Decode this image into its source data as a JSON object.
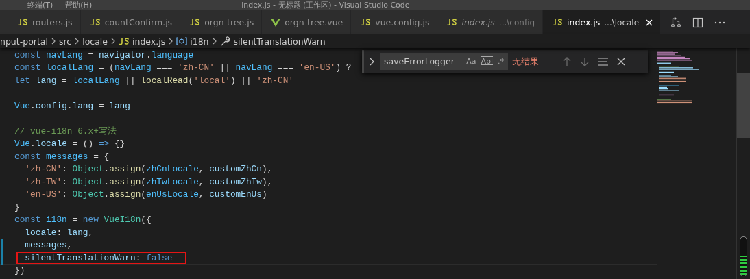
{
  "menu": [
    "终端(T)",
    "帮助(H)"
  ],
  "window": {
    "title": "index.js - 无标题 (工作区) - Visual Studio Code"
  },
  "tabs": [
    {
      "label": "routers.js",
      "kind": "js",
      "selected": false,
      "preview": false
    },
    {
      "label": "countConfirm.js",
      "kind": "js",
      "selected": false,
      "preview": false
    },
    {
      "label": "orgn-tree.js",
      "kind": "js",
      "selected": false,
      "preview": false
    },
    {
      "label": "orgn-tree.vue",
      "kind": "vue",
      "selected": false,
      "preview": false
    },
    {
      "label": "vue.config.js",
      "kind": "js",
      "selected": false,
      "preview": false
    },
    {
      "label": "index.js",
      "path": "...\\config",
      "kind": "js",
      "selected": false,
      "preview": true
    },
    {
      "label": "index.js",
      "path": "...\\locale",
      "kind": "js",
      "selected": true,
      "preview": false
    }
  ],
  "breadcrumb": [
    {
      "label": "nput-portal",
      "kind": "folder"
    },
    {
      "label": "src",
      "kind": "folder"
    },
    {
      "label": "locale",
      "kind": "folder"
    },
    {
      "label": "index.js",
      "kind": "js"
    },
    {
      "label": "i18n",
      "kind": "module"
    },
    {
      "label": "silentTranslationWarn",
      "kind": "property"
    }
  ],
  "find": {
    "value": "saveErrorLogger",
    "options": [
      "Aa",
      "Abl",
      ".*"
    ],
    "result": "无结果"
  },
  "code": [
    {
      "modified": false,
      "highlighted": false,
      "tokens": [
        {
          "kind": "keyword",
          "text": "const "
        },
        {
          "kind": "constant",
          "text": "navLang"
        },
        {
          "kind": "plain",
          "text": " = "
        },
        {
          "kind": "variable",
          "text": "navigator"
        },
        {
          "kind": "plain",
          "text": "."
        },
        {
          "kind": "constant",
          "text": "language"
        }
      ]
    },
    {
      "modified": false,
      "highlighted": false,
      "tokens": [
        {
          "kind": "keyword",
          "text": "const "
        },
        {
          "kind": "constant",
          "text": "localLang"
        },
        {
          "kind": "plain",
          "text": " = ("
        },
        {
          "kind": "constant",
          "text": "navLang"
        },
        {
          "kind": "plain",
          "text": " === "
        },
        {
          "kind": "string",
          "text": "'zh-CN'"
        },
        {
          "kind": "plain",
          "text": " || "
        },
        {
          "kind": "constant",
          "text": "navLang"
        },
        {
          "kind": "plain",
          "text": " === "
        },
        {
          "kind": "string",
          "text": "'en-US'"
        },
        {
          "kind": "plain",
          "text": ") ?"
        }
      ]
    },
    {
      "modified": false,
      "highlighted": false,
      "tokens": [
        {
          "kind": "keyword",
          "text": "let "
        },
        {
          "kind": "variable",
          "text": "lang"
        },
        {
          "kind": "plain",
          "text": " = "
        },
        {
          "kind": "constant",
          "text": "localLang"
        },
        {
          "kind": "plain",
          "text": " || "
        },
        {
          "kind": "function",
          "text": "localRead"
        },
        {
          "kind": "plain",
          "text": "("
        },
        {
          "kind": "string",
          "text": "'local'"
        },
        {
          "kind": "plain",
          "text": ") || "
        },
        {
          "kind": "string",
          "text": "'zh-CN'"
        }
      ]
    },
    {
      "modified": false,
      "highlighted": false
    },
    {
      "modified": false,
      "highlighted": false,
      "tokens": [
        {
          "kind": "constant",
          "text": "Vue"
        },
        {
          "kind": "plain",
          "text": "."
        },
        {
          "kind": "variable",
          "text": "config"
        },
        {
          "kind": "plain",
          "text": "."
        },
        {
          "kind": "variable",
          "text": "lang"
        },
        {
          "kind": "plain",
          "text": " = "
        },
        {
          "kind": "variable",
          "text": "lang"
        }
      ]
    },
    {
      "modified": false,
      "highlighted": false
    },
    {
      "modified": false,
      "highlighted": false,
      "tokens": [
        {
          "kind": "comment",
          "text": "// vue-i18n 6.x+写法"
        }
      ]
    },
    {
      "modified": false,
      "highlighted": false,
      "tokens": [
        {
          "kind": "constant",
          "text": "Vue"
        },
        {
          "kind": "plain",
          "text": "."
        },
        {
          "kind": "variable",
          "text": "locale"
        },
        {
          "kind": "plain",
          "text": " = () "
        },
        {
          "kind": "keyword",
          "text": "=>"
        },
        {
          "kind": "plain",
          "text": " {}"
        }
      ]
    },
    {
      "modified": false,
      "highlighted": false,
      "tokens": [
        {
          "kind": "keyword",
          "text": "const "
        },
        {
          "kind": "constant",
          "text": "messages"
        },
        {
          "kind": "plain",
          "text": " = {"
        }
      ]
    },
    {
      "modified": false,
      "highlighted": false,
      "tokens": [
        {
          "kind": "string",
          "text": "  'zh-CN'"
        },
        {
          "kind": "plain",
          "text": ": "
        },
        {
          "kind": "class",
          "text": "Object"
        },
        {
          "kind": "plain",
          "text": "."
        },
        {
          "kind": "function",
          "text": "assign"
        },
        {
          "kind": "plain",
          "text": "("
        },
        {
          "kind": "constant",
          "text": "zhCnLocale"
        },
        {
          "kind": "plain",
          "text": ", "
        },
        {
          "kind": "variable",
          "text": "customZhCn"
        },
        {
          "kind": "plain",
          "text": "),"
        }
      ]
    },
    {
      "modified": false,
      "highlighted": false,
      "tokens": [
        {
          "kind": "string",
          "text": "  'zh-TW'"
        },
        {
          "kind": "plain",
          "text": ": "
        },
        {
          "kind": "class",
          "text": "Object"
        },
        {
          "kind": "plain",
          "text": "."
        },
        {
          "kind": "function",
          "text": "assign"
        },
        {
          "kind": "plain",
          "text": "("
        },
        {
          "kind": "constant",
          "text": "zhTwLocale"
        },
        {
          "kind": "plain",
          "text": ", "
        },
        {
          "kind": "variable",
          "text": "customZhTw"
        },
        {
          "kind": "plain",
          "text": "),"
        }
      ]
    },
    {
      "modified": false,
      "highlighted": false,
      "tokens": [
        {
          "kind": "string",
          "text": "  'en-US'"
        },
        {
          "kind": "plain",
          "text": ": "
        },
        {
          "kind": "class",
          "text": "Object"
        },
        {
          "kind": "plain",
          "text": "."
        },
        {
          "kind": "function",
          "text": "assign"
        },
        {
          "kind": "plain",
          "text": "("
        },
        {
          "kind": "constant",
          "text": "enUsLocale"
        },
        {
          "kind": "plain",
          "text": ", "
        },
        {
          "kind": "variable",
          "text": "customEnUs"
        },
        {
          "kind": "plain",
          "text": ")"
        }
      ]
    },
    {
      "modified": false,
      "highlighted": false,
      "tokens": [
        {
          "kind": "plain",
          "text": "}"
        }
      ]
    },
    {
      "modified": false,
      "highlighted": false,
      "tokens": [
        {
          "kind": "keyword",
          "text": "const "
        },
        {
          "kind": "constant",
          "text": "i18n"
        },
        {
          "kind": "plain",
          "text": " = "
        },
        {
          "kind": "keyword",
          "text": "new "
        },
        {
          "kind": "class",
          "text": "VueI18n"
        },
        {
          "kind": "plain",
          "text": "({"
        }
      ]
    },
    {
      "modified": false,
      "highlighted": false,
      "tokens": [
        {
          "kind": "variable",
          "text": "  locale"
        },
        {
          "kind": "plain",
          "text": ": "
        },
        {
          "kind": "variable",
          "text": "lang"
        },
        {
          "kind": "plain",
          "text": ","
        }
      ]
    },
    {
      "modified": true,
      "highlighted": false,
      "tokens": [
        {
          "kind": "variable",
          "text": "  messages"
        },
        {
          "kind": "plain",
          "text": ","
        }
      ]
    },
    {
      "modified": true,
      "highlighted": true,
      "tokens": [
        {
          "kind": "variable",
          "text": "  silentTranslationWarn"
        },
        {
          "kind": "plain",
          "text": ": "
        },
        {
          "kind": "keyword",
          "text": "false"
        }
      ]
    },
    {
      "modified": false,
      "highlighted": false,
      "tokens": [
        {
          "kind": "plain",
          "text": "})"
        }
      ]
    }
  ],
  "meter": {
    "level": 0.5
  }
}
